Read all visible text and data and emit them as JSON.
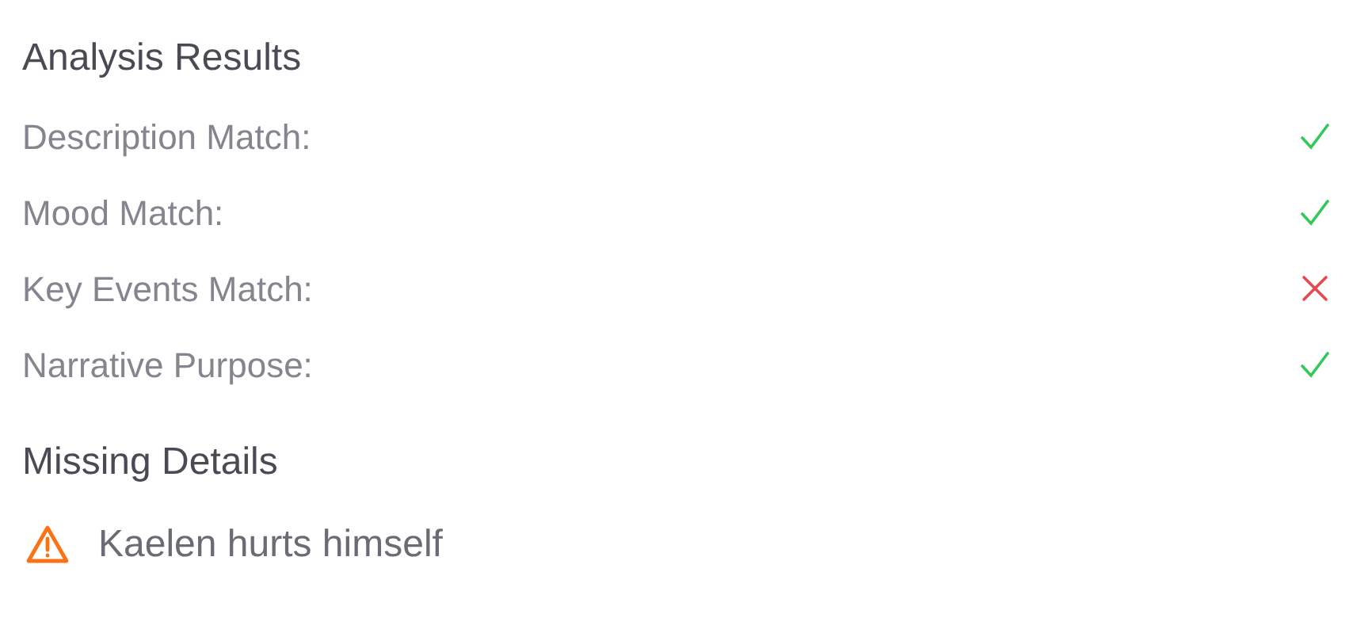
{
  "analysis": {
    "title": "Analysis Results",
    "items": [
      {
        "label": "Description Match:",
        "matched": true
      },
      {
        "label": "Mood Match:",
        "matched": true
      },
      {
        "label": "Key Events Match:",
        "matched": false
      },
      {
        "label": "Narrative Purpose:",
        "matched": true
      }
    ]
  },
  "missing": {
    "title": "Missing Details",
    "items": [
      {
        "text": "Kaelen hurts himself"
      }
    ]
  }
}
